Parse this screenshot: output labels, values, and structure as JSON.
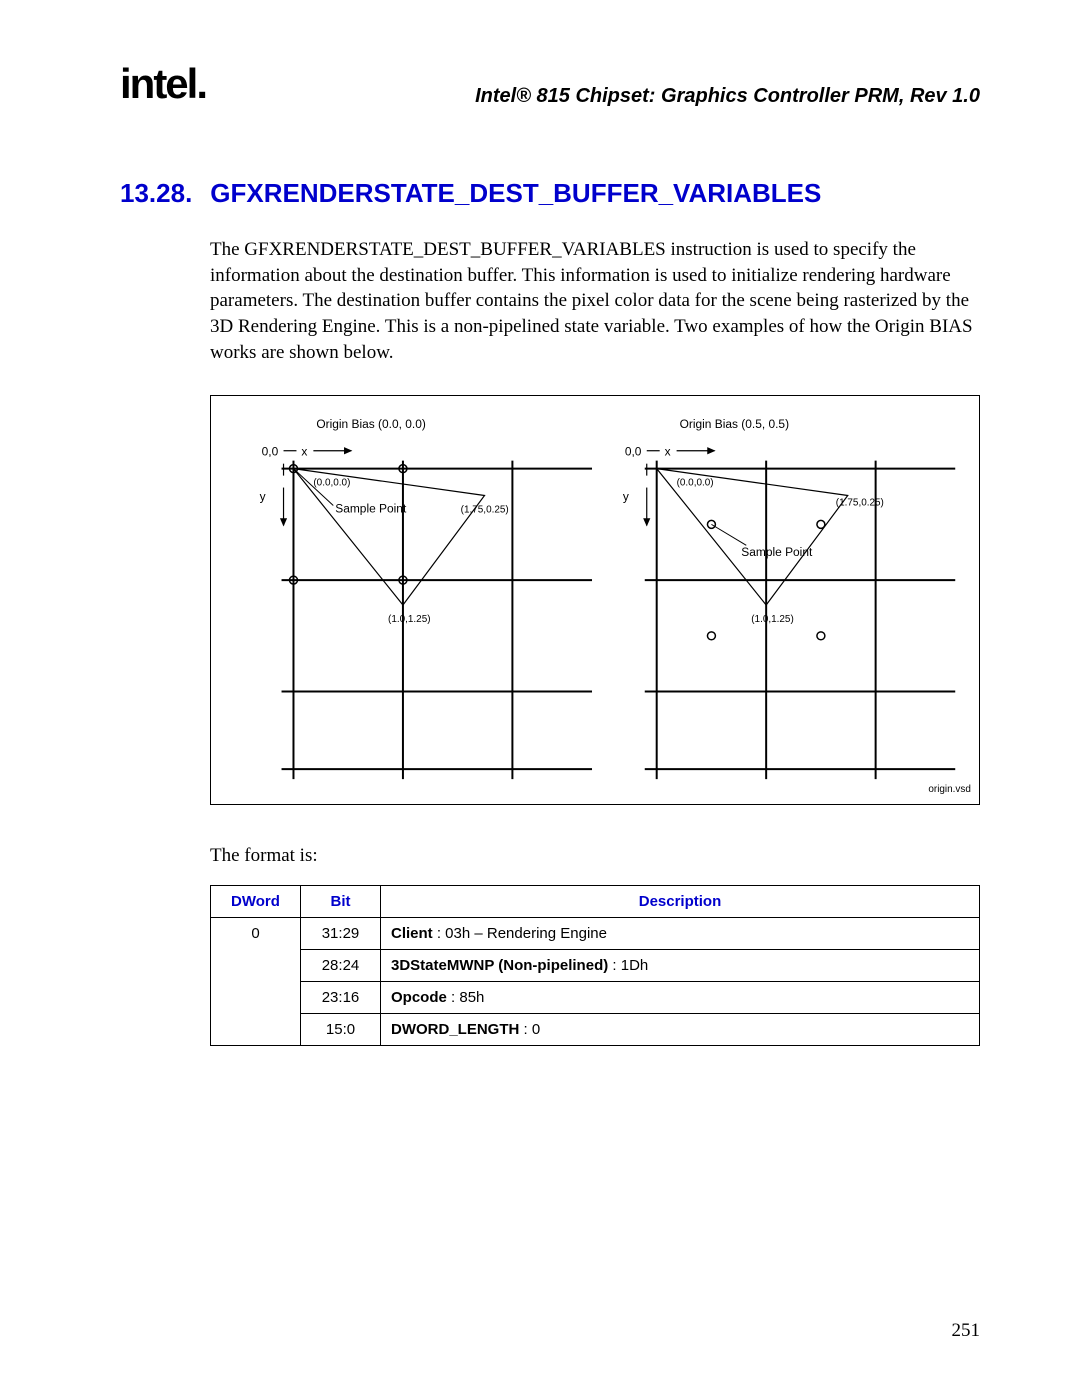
{
  "header": {
    "logo_text": "intel.",
    "doc_title": "Intel® 815 Chipset: Graphics Controller PRM, Rev 1.0"
  },
  "section": {
    "number": "13.28.",
    "title": "GFXRENDERSTATE_DEST_BUFFER_VARIABLES"
  },
  "body_paragraph": "The GFXRENDERSTATE_DEST_BUFFER_VARIABLES instruction is used to specify the information about the destination buffer. This information is used to initialize rendering hardware parameters. The destination buffer contains the pixel color data for the scene being rasterized by the 3D Rendering Engine. This is a non-pipelined state variable. Two examples of how the Origin BIAS works are shown below.",
  "diagram": {
    "left": {
      "title": "Origin Bias (0.0, 0.0)",
      "origin": "0,0",
      "x_axis": "x",
      "y_axis": "y",
      "pt_tl": "(0.0,0.0)",
      "pt_tr": "(1.75,0.25)",
      "pt_b": "(1.0,1.25)",
      "sample_label": "Sample Point"
    },
    "right": {
      "title": "Origin Bias (0.5, 0.5)",
      "origin": "0,0",
      "x_axis": "x",
      "y_axis": "y",
      "pt_tl": "(0.0,0.0)",
      "pt_tr": "(1.75,0.25)",
      "pt_b": "(1.0,1.25)",
      "sample_label": "Sample Point"
    },
    "filename": "origin.vsd"
  },
  "format_line": "The format is:",
  "table": {
    "headers": {
      "dword": "DWord",
      "bit": "Bit",
      "description": "Description"
    },
    "rows": [
      {
        "dword": "0",
        "bit": "31:29",
        "desc_strong": "Client",
        "desc_rest": " : 03h – Rendering Engine"
      },
      {
        "dword": "",
        "bit": "28:24",
        "desc_strong": "3DStateMWNP (Non-pipelined)",
        "desc_rest": " : 1Dh"
      },
      {
        "dword": "",
        "bit": "23:16",
        "desc_strong": "Opcode",
        "desc_rest": " : 85h"
      },
      {
        "dword": "",
        "bit": "15:0",
        "desc_strong": "DWORD_LENGTH",
        "desc_rest": " : 0"
      }
    ]
  },
  "page_number": "251"
}
